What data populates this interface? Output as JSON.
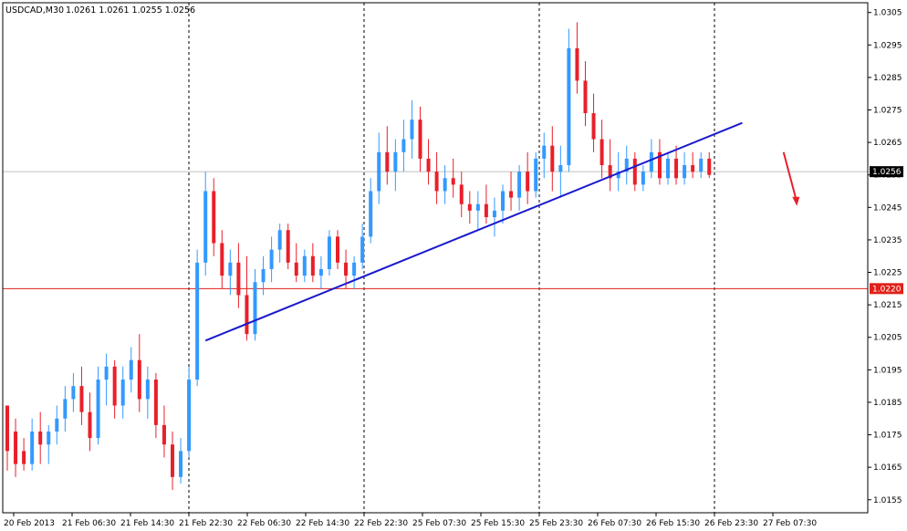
{
  "chart_title": "USDCAD,M30",
  "ohlc_header": "1.0261 1.0261 1.0255 1.0256",
  "chart_data": {
    "type": "candlestick",
    "symbol": "USDCAD",
    "timeframe": "M30",
    "ylim": [
      1.0151,
      1.0308
    ],
    "y_ticks": [
      "1.0305",
      "1.0295",
      "1.0285",
      "1.0275",
      "1.0265",
      "1.0255",
      "1.0245",
      "1.0235",
      "1.0225",
      "1.0215",
      "1.0205",
      "1.0195",
      "1.0185",
      "1.0175",
      "1.0165",
      "1.0155"
    ],
    "x_ticks": [
      "20 Feb 2013",
      "21 Feb 06:30",
      "21 Feb 14:30",
      "21 Feb 22:30",
      "22 Feb 06:30",
      "22 Feb 14:30",
      "22 Feb 22:30",
      "25 Feb 07:30",
      "25 Feb 15:30",
      "25 Feb 23:30",
      "26 Feb 07:30",
      "26 Feb 15:30",
      "26 Feb 23:30",
      "27 Feb 07:30"
    ],
    "current_price": {
      "value": 1.0256,
      "label": "1.0256"
    },
    "support_level": {
      "value": 1.022,
      "label": "1.0220"
    },
    "trendline": {
      "from": {
        "bar": 24,
        "price": 1.0204
      },
      "to": {
        "bar": 89,
        "price": 1.0271
      }
    },
    "colors": {
      "bull": "#3399ff",
      "bear": "#e8202a",
      "grid": "#000000",
      "current_line": "#c0c0c0",
      "support_line": "#e0201a",
      "trendline": "#1a1acc",
      "arrow": "#e8202a"
    },
    "grid": "vertical-dashed",
    "candles": [
      [
        1.0184,
        1.0184,
        1.0164,
        1.017
      ],
      [
        1.0176,
        1.018,
        1.0162,
        1.0166
      ],
      [
        1.017,
        1.0174,
        1.0164,
        1.0166
      ],
      [
        1.0166,
        1.018,
        1.0164,
        1.0176
      ],
      [
        1.0176,
        1.0182,
        1.0166,
        1.0172
      ],
      [
        1.0172,
        1.0178,
        1.0166,
        1.0176
      ],
      [
        1.0176,
        1.0184,
        1.0172,
        1.018
      ],
      [
        1.018,
        1.019,
        1.0176,
        1.0186
      ],
      [
        1.0186,
        1.0194,
        1.0182,
        1.019
      ],
      [
        1.019,
        1.0196,
        1.0178,
        1.0182
      ],
      [
        1.0182,
        1.0188,
        1.017,
        1.0174
      ],
      [
        1.0174,
        1.0196,
        1.0172,
        1.0192
      ],
      [
        1.0192,
        1.02,
        1.0184,
        1.0196
      ],
      [
        1.0196,
        1.0198,
        1.018,
        1.0184
      ],
      [
        1.0184,
        1.0196,
        1.018,
        1.0192
      ],
      [
        1.0192,
        1.0202,
        1.0188,
        1.0198
      ],
      [
        1.0198,
        1.0206,
        1.0182,
        1.0186
      ],
      [
        1.0186,
        1.0196,
        1.018,
        1.0192
      ],
      [
        1.0192,
        1.0194,
        1.0174,
        1.0178
      ],
      [
        1.0178,
        1.0184,
        1.0168,
        1.0172
      ],
      [
        1.0172,
        1.0176,
        1.0158,
        1.0162
      ],
      [
        1.0162,
        1.0174,
        1.016,
        1.017
      ],
      [
        1.017,
        1.0196,
        1.0168,
        1.0192
      ],
      [
        1.0192,
        1.0232,
        1.019,
        1.0228
      ],
      [
        1.0228,
        1.0256,
        1.0224,
        1.025
      ],
      [
        1.025,
        1.0254,
        1.023,
        1.0234
      ],
      [
        1.0234,
        1.0238,
        1.022,
        1.0224
      ],
      [
        1.0224,
        1.0232,
        1.0218,
        1.0228
      ],
      [
        1.0228,
        1.0234,
        1.0214,
        1.0218
      ],
      [
        1.0218,
        1.023,
        1.0204,
        1.0206
      ],
      [
        1.0206,
        1.0226,
        1.0204,
        1.0222
      ],
      [
        1.0222,
        1.023,
        1.0218,
        1.0226
      ],
      [
        1.0226,
        1.0236,
        1.0222,
        1.0232
      ],
      [
        1.0232,
        1.024,
        1.0228,
        1.0238
      ],
      [
        1.0238,
        1.024,
        1.0226,
        1.0228
      ],
      [
        1.0228,
        1.0234,
        1.0222,
        1.0224
      ],
      [
        1.0224,
        1.0232,
        1.0222,
        1.023
      ],
      [
        1.023,
        1.0234,
        1.0222,
        1.0224
      ],
      [
        1.0224,
        1.023,
        1.022,
        1.0226
      ],
      [
        1.0226,
        1.0238,
        1.0224,
        1.0236
      ],
      [
        1.0236,
        1.0238,
        1.0226,
        1.0228
      ],
      [
        1.0228,
        1.0232,
        1.022,
        1.0224
      ],
      [
        1.0224,
        1.023,
        1.022,
        1.0228
      ],
      [
        1.0228,
        1.024,
        1.0226,
        1.0236
      ],
      [
        1.0236,
        1.0254,
        1.0234,
        1.025
      ],
      [
        1.025,
        1.0268,
        1.0246,
        1.0262
      ],
      [
        1.0262,
        1.027,
        1.0252,
        1.0256
      ],
      [
        1.0256,
        1.0266,
        1.025,
        1.0262
      ],
      [
        1.0262,
        1.0272,
        1.0256,
        1.0266
      ],
      [
        1.0266,
        1.0278,
        1.026,
        1.0272
      ],
      [
        1.0272,
        1.0276,
        1.0256,
        1.026
      ],
      [
        1.026,
        1.0266,
        1.0252,
        1.0256
      ],
      [
        1.0256,
        1.0262,
        1.0246,
        1.025
      ],
      [
        1.025,
        1.0258,
        1.0246,
        1.0254
      ],
      [
        1.0254,
        1.026,
        1.0248,
        1.0252
      ],
      [
        1.0252,
        1.0256,
        1.0242,
        1.0246
      ],
      [
        1.0246,
        1.025,
        1.024,
        1.0244
      ],
      [
        1.0244,
        1.025,
        1.0238,
        1.0246
      ],
      [
        1.0246,
        1.0252,
        1.024,
        1.0242
      ],
      [
        1.0242,
        1.0248,
        1.0236,
        1.0244
      ],
      [
        1.0244,
        1.0252,
        1.024,
        1.025
      ],
      [
        1.025,
        1.0256,
        1.0244,
        1.0248
      ],
      [
        1.0248,
        1.0258,
        1.0244,
        1.0256
      ],
      [
        1.0256,
        1.0262,
        1.0246,
        1.025
      ],
      [
        1.025,
        1.0262,
        1.0248,
        1.026
      ],
      [
        1.026,
        1.0268,
        1.0254,
        1.0264
      ],
      [
        1.0264,
        1.027,
        1.025,
        1.0256
      ],
      [
        1.0256,
        1.0264,
        1.0248,
        1.0258
      ],
      [
        1.0258,
        1.03,
        1.0256,
        1.0294
      ],
      [
        1.0294,
        1.0302,
        1.028,
        1.0284
      ],
      [
        1.0284,
        1.029,
        1.027,
        1.0274
      ],
      [
        1.0274,
        1.028,
        1.0262,
        1.0266
      ],
      [
        1.0266,
        1.0272,
        1.0254,
        1.0258
      ],
      [
        1.0258,
        1.0266,
        1.025,
        1.0254
      ],
      [
        1.0254,
        1.0262,
        1.025,
        1.0256
      ],
      [
        1.0256,
        1.0264,
        1.0252,
        1.026
      ],
      [
        1.026,
        1.0262,
        1.025,
        1.0252
      ],
      [
        1.0252,
        1.0258,
        1.025,
        1.0256
      ],
      [
        1.0256,
        1.0266,
        1.0254,
        1.0262
      ],
      [
        1.0262,
        1.0266,
        1.0252,
        1.0254
      ],
      [
        1.0254,
        1.0262,
        1.0252,
        1.026
      ],
      [
        1.026,
        1.0264,
        1.0252,
        1.0254
      ],
      [
        1.0254,
        1.0262,
        1.0252,
        1.0258
      ],
      [
        1.0258,
        1.0262,
        1.0254,
        1.0256
      ],
      [
        1.0256,
        1.0262,
        1.0254,
        1.026
      ],
      [
        1.026,
        1.0262,
        1.0254,
        1.0255
      ]
    ],
    "annotation_arrow": {
      "from": {
        "bar": 94,
        "price": 1.0262
      },
      "to": {
        "bar": 95.5,
        "price": 1.0246
      }
    }
  }
}
